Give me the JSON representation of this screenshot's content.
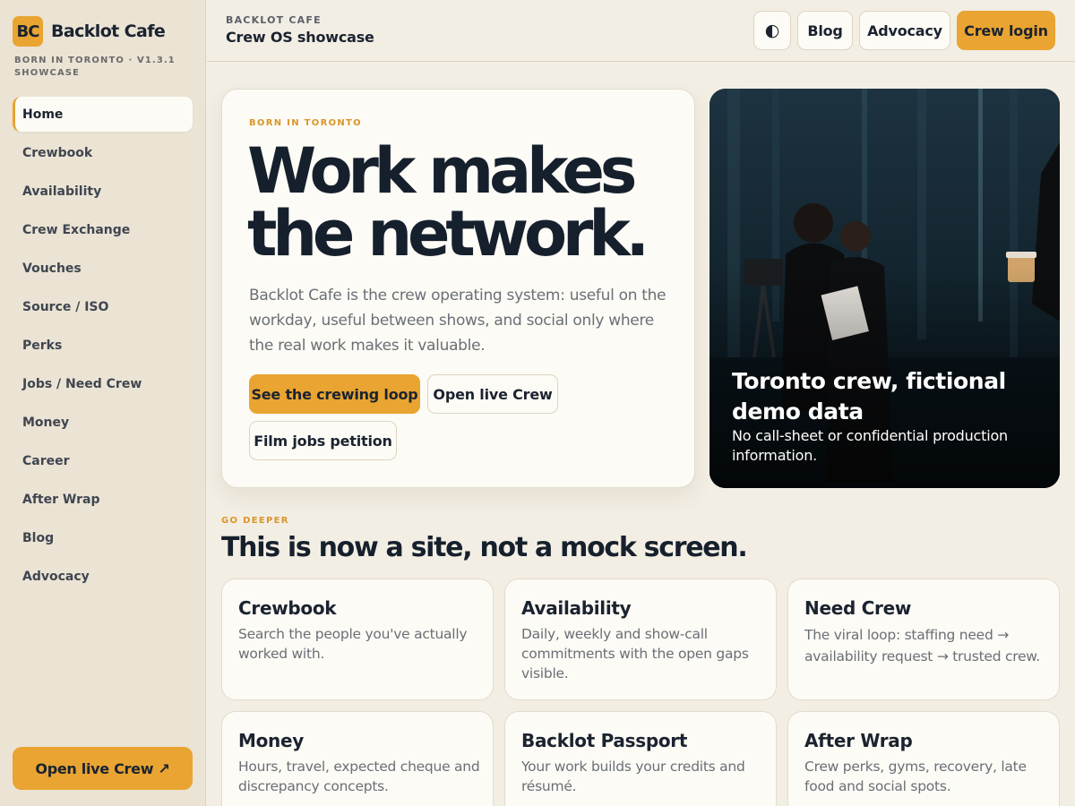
{
  "brand": {
    "logo": "BC",
    "name": "Backlot Cafe",
    "tagline": "BORN IN TORONTO · V1.3.1 SHOWCASE"
  },
  "nav": {
    "items": [
      {
        "label": "Home",
        "active": true
      },
      {
        "label": "Crewbook"
      },
      {
        "label": "Availability"
      },
      {
        "label": "Crew Exchange"
      },
      {
        "label": "Vouches"
      },
      {
        "label": "Source / ISO"
      },
      {
        "label": "Perks"
      },
      {
        "label": "Jobs / Need Crew"
      },
      {
        "label": "Money"
      },
      {
        "label": "Career"
      },
      {
        "label": "After Wrap"
      },
      {
        "label": "Blog"
      },
      {
        "label": "Advocacy"
      }
    ],
    "cta": "Open live Crew ↗"
  },
  "header": {
    "kicker": "BACKLOT CAFE",
    "title": "Crew OS showcase",
    "theme_icon": "◐",
    "blog": "Blog",
    "advocacy": "Advocacy",
    "login": "Crew login"
  },
  "hero": {
    "kicker": "BORN IN TORONTO",
    "title": "Work makes the network.",
    "body": "Backlot Cafe is the crew operating system: useful on the workday, useful between shows, and social only where the real work makes it valuable.",
    "btn_primary": "See the crewing loop",
    "btn_secondary": "Open live Crew",
    "btn_petition": "Film jobs petition"
  },
  "photo": {
    "title": "Toronto crew, fictional demo data",
    "subtitle": "No call-sheet or confidential production information."
  },
  "deeper": {
    "kicker": "GO DEEPER",
    "title": "This is now a site, not a mock screen.",
    "cards": [
      {
        "title": "Crewbook",
        "desc": "Search the people you've actually worked with."
      },
      {
        "title": "Availability",
        "desc": "Daily, weekly and show-call commitments with the open gaps visible."
      },
      {
        "title": "Need Crew",
        "desc": "The viral loop: staffing need → availability request → trusted crew."
      },
      {
        "title": "Money",
        "desc": "Hours, travel, expected cheque and discrepancy concepts."
      },
      {
        "title": "Backlot Passport",
        "desc": "Your work builds your credits and résumé."
      },
      {
        "title": "After Wrap",
        "desc": "Crew perks, gyms, recovery, late food and social spots."
      }
    ]
  },
  "colors": {
    "accent": "#e9a431",
    "background": "#f3eee4",
    "sidebar": "#ebe3d4",
    "card": "#fdfbf5",
    "ink": "#16202d"
  }
}
